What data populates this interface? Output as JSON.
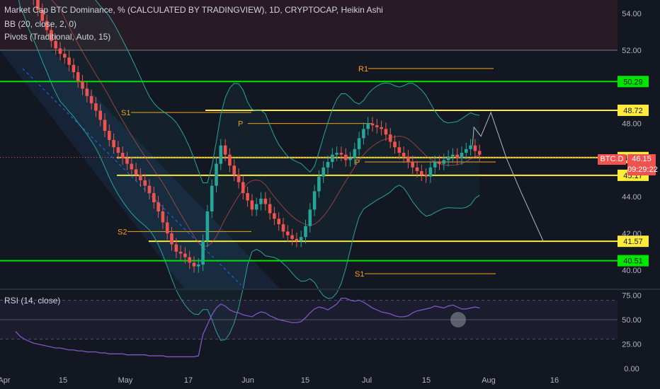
{
  "legend": {
    "title": "Market Cap BTC Dominance, % (CALCULATED BY TRADINGVIEW), 1D, CRYPTOCAP, Heikin Ashi",
    "bb": "BB (20, close, 2, 0)",
    "pivots": "Pivots (Traditional, Auto, 15)",
    "rsi": "RSI (14, close)"
  },
  "colors": {
    "background": "#131722",
    "up": "#26a69a",
    "down": "#ef5350",
    "green_level": "#00e600",
    "yellow_level": "#ffeb3b",
    "pivot": "#f7a21b",
    "rsi": "#7e57c2",
    "projection": "#b2b5be"
  },
  "price_tag": {
    "symbol": "BTC.D",
    "price": "46.15",
    "countdown": "09:29:22"
  },
  "chart_data": [
    {
      "type": "candlestick",
      "title": "Market Cap BTC Dominance, % (CALCULATED BY TRADINGVIEW), 1D, CRYPTOCAP, Heikin Ashi",
      "y_ticks": [
        "54.00",
        "52.00",
        "48.00",
        "46.00",
        "44.00",
        "42.00",
        "40.00"
      ],
      "x_ticks": [
        "Apr",
        "15",
        "May",
        "17",
        "Jun",
        "15",
        "Jul",
        "15",
        "Aug",
        "16"
      ],
      "ylim": [
        39.0,
        55.0
      ],
      "horizontal_levels": [
        {
          "value": 50.29,
          "label": "50.29",
          "color": "green"
        },
        {
          "value": 48.72,
          "label": "48.72",
          "color": "yellow"
        },
        {
          "value": 46.14,
          "label": "46.14",
          "color": "yellow"
        },
        {
          "value": 45.17,
          "label": "45.17",
          "color": "yellow"
        },
        {
          "value": 41.57,
          "label": "41.57",
          "color": "yellow"
        },
        {
          "value": 40.51,
          "label": "40.51",
          "color": "green"
        },
        {
          "value": 52.0,
          "label": "",
          "color": "grey"
        }
      ],
      "pivot_labels": [
        {
          "label": "R1",
          "value": 51.0
        },
        {
          "label": "S1",
          "value": 48.6
        },
        {
          "label": "P",
          "value": 48.0
        },
        {
          "label": "P",
          "value": 45.9
        },
        {
          "label": "S2",
          "value": 42.1
        },
        {
          "label": "S1",
          "value": 39.8
        }
      ],
      "closes": [
        57.2,
        56.4,
        55.9,
        55.2,
        54.8,
        54.2,
        53.6,
        53.1,
        52.5,
        52.1,
        51.8,
        51.6,
        51.2,
        50.8,
        50.3,
        49.9,
        49.5,
        49.1,
        48.7,
        48.2,
        47.6,
        47.1,
        46.7,
        46.4,
        46.1,
        45.8,
        45.5,
        45.2,
        44.9,
        44.6,
        44.2,
        43.7,
        43.2,
        42.6,
        42.0,
        41.4,
        41.0,
        40.9,
        40.7,
        40.4,
        40.2,
        40.3,
        41.6,
        43.2,
        44.6,
        45.8,
        46.8,
        46.3,
        45.7,
        45.2,
        44.8,
        44.2,
        43.8,
        43.3,
        43.6,
        43.9,
        43.6,
        43.1,
        42.8,
        42.5,
        42.1,
        41.9,
        41.7,
        41.6,
        41.8,
        42.4,
        43.3,
        44.3,
        45.1,
        45.6,
        45.9,
        46.3,
        46.4,
        46.3,
        46.0,
        46.1,
        46.6,
        47.2,
        47.7,
        48.0,
        47.9,
        47.8,
        47.7,
        47.4,
        47.0,
        46.7,
        46.4,
        46.2,
        45.9,
        45.6,
        45.4,
        45.2,
        45.1,
        45.6,
        45.9,
        45.8,
        46.0,
        46.2,
        46.3,
        46.1,
        46.4,
        46.6,
        46.8,
        46.5,
        46.3
      ]
    },
    {
      "type": "line",
      "title": "RSI (14, close)",
      "y_ticks": [
        "75.00",
        "50.00",
        "25.00",
        "0.00"
      ],
      "ylim": [
        0,
        100
      ],
      "bands": [
        30,
        50,
        70
      ],
      "series": [
        {
          "values": [
            38,
            33,
            30,
            28,
            26,
            25,
            24,
            23,
            22,
            21,
            21,
            20,
            19,
            19,
            18,
            18,
            17,
            17,
            17,
            16,
            16,
            15,
            15,
            15,
            15,
            14,
            14,
            14,
            14,
            14,
            13,
            13,
            13,
            13,
            12,
            12,
            12,
            12,
            12,
            12,
            12,
            13,
            35,
            45,
            55,
            62,
            66,
            64,
            60,
            58,
            57,
            55,
            54,
            53,
            56,
            58,
            57,
            54,
            52,
            50,
            49,
            48,
            47,
            47,
            48,
            52,
            57,
            61,
            63,
            62,
            60,
            63,
            66,
            72,
            72,
            70,
            69,
            70,
            68,
            65,
            62,
            60,
            58,
            57,
            56,
            54,
            53,
            53,
            54,
            57,
            59,
            60,
            61,
            62,
            64,
            63,
            62,
            64,
            65,
            63,
            61,
            61,
            62,
            63,
            62
          ]
        }
      ]
    }
  ]
}
